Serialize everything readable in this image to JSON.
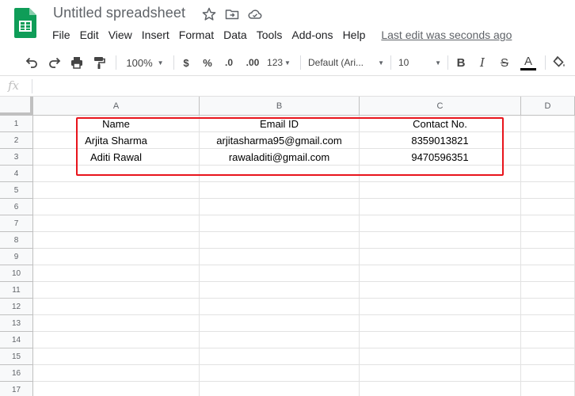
{
  "app": {
    "title": "Untitled spreadsheet",
    "logo_icon": "sheets-logo-icon",
    "title_icons": [
      "star-icon",
      "move-to-folder-icon",
      "cloud-saved-icon"
    ]
  },
  "menu": {
    "items": [
      "File",
      "Edit",
      "View",
      "Insert",
      "Format",
      "Data",
      "Tools",
      "Add-ons",
      "Help"
    ],
    "last_edit": "Last edit was seconds ago"
  },
  "toolbar": {
    "zoom": "100%",
    "currency": "$",
    "percent": "%",
    "decrease_decimal": ".0",
    "increase_decimal": ".00",
    "more_formats": "123",
    "font": "Default (Ari...",
    "font_size": "10",
    "bold": "B",
    "italic": "I",
    "strikethrough": "S",
    "text_color": "A",
    "icons": [
      "undo-icon",
      "redo-icon",
      "print-icon",
      "paint-format-icon",
      "fill-color-icon"
    ]
  },
  "formula_bar": {
    "label": "fx",
    "value": ""
  },
  "sheet": {
    "columns": [
      "A",
      "B",
      "C",
      "D"
    ],
    "rows": [
      "1",
      "2",
      "3",
      "4",
      "5",
      "6",
      "7",
      "8",
      "9",
      "10",
      "11",
      "12",
      "13",
      "14",
      "15",
      "16",
      "17"
    ],
    "cells": [
      [
        "Name",
        "Email ID",
        "Contact No."
      ],
      [
        "Arjita Sharma",
        "arjitasharma95@gmail.com",
        "8359013821"
      ],
      [
        "Aditi Rawal",
        "rawaladiti@gmail.com",
        "9470596351"
      ]
    ]
  },
  "colors": {
    "highlight_border": "#e8141c",
    "sheets_green": "#0f9d58",
    "text_color_underline": "#000000"
  }
}
